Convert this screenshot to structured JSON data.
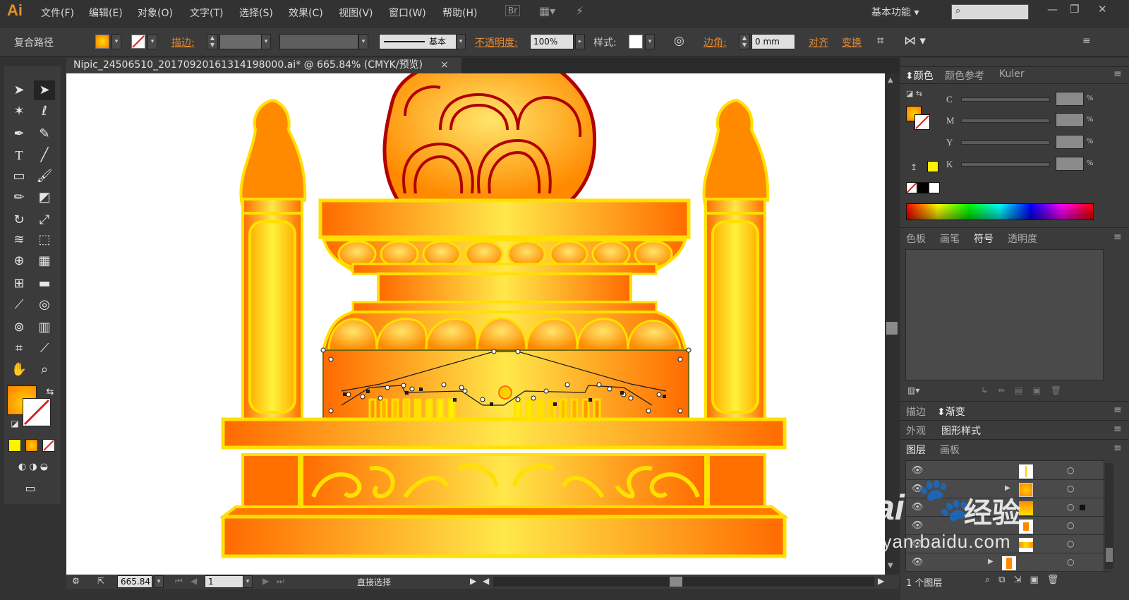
{
  "app": {
    "logo": "Ai"
  },
  "menu": {
    "items": [
      "文件(F)",
      "编辑(E)",
      "对象(O)",
      "文字(T)",
      "选择(S)",
      "效果(C)",
      "视图(V)",
      "窗口(W)",
      "帮助(H)"
    ],
    "bridge": "Br"
  },
  "workspace": {
    "label": "基本功能"
  },
  "control": {
    "object_type": "复合路径",
    "stroke_label": "描边",
    "stroke_profile": "基本",
    "opacity_label": "不透明度",
    "opacity_value": "100%",
    "style_label": "样式",
    "corner_label": "边角",
    "corner_value": "0 mm",
    "align_label": "对齐",
    "transform_label": "变换",
    "colon": ":"
  },
  "document": {
    "tab_title": "Nipic_24506510_20170920161314198000.ai* @ 665.84% (CMYK/预览)",
    "close": "×"
  },
  "status": {
    "zoom": "665.84",
    "artboard": "1",
    "tool": "直接选择"
  },
  "panels": {
    "color_tabs": [
      "颜色",
      "颜色参考",
      "Kuler"
    ],
    "cmyk": [
      {
        "label": "C",
        "unit": "%"
      },
      {
        "label": "M",
        "unit": "%"
      },
      {
        "label": "Y",
        "unit": "%"
      },
      {
        "label": "K",
        "unit": "%"
      }
    ],
    "swatch_tabs": [
      "色板",
      "画笔",
      "符号",
      "透明度"
    ],
    "stroke_tabs": [
      "描边",
      "渐变"
    ],
    "appearance_tabs": [
      "外观",
      "图形样式"
    ],
    "layer_tabs": [
      "图层",
      "画板"
    ],
    "layers_count": "1 个图层"
  },
  "watermark": {
    "brand": "Bai",
    "brand_suffix": "经验",
    "url": "jingyan.baidu.com"
  },
  "colors": {
    "accent": "#e8892b",
    "fill_orange": "#ff8c00",
    "gold": "#ffd400",
    "yellow": "#fff200"
  }
}
